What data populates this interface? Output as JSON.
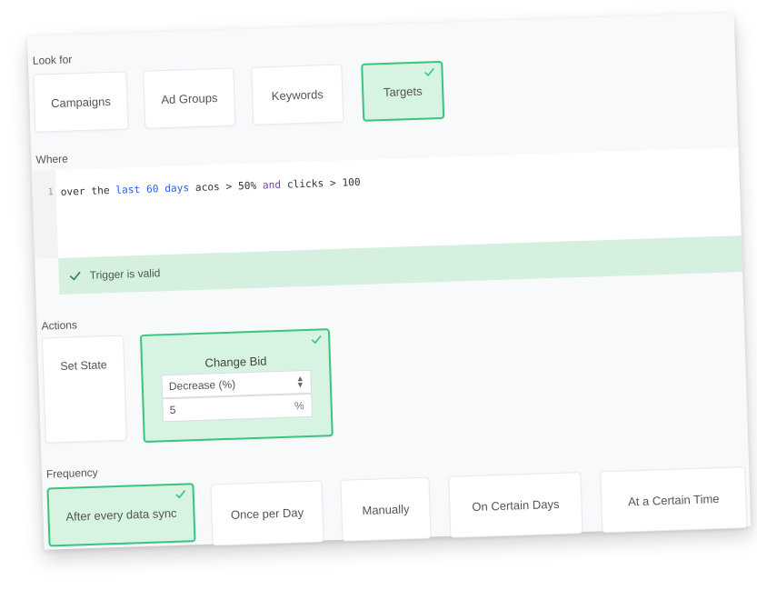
{
  "look_for": {
    "label": "Look for",
    "options": [
      {
        "label": "Campaigns",
        "selected": false
      },
      {
        "label": "Ad Groups",
        "selected": false
      },
      {
        "label": "Keywords",
        "selected": false
      },
      {
        "label": "Targets",
        "selected": true
      }
    ]
  },
  "where": {
    "label": "Where",
    "line_number": "1",
    "code_tokens": {
      "over_the": "over the ",
      "last": "last",
      "sp1": " ",
      "sixty": "60",
      "sp2": " ",
      "days": "days",
      "acos_part": " acos > 50% ",
      "and": "and",
      "clicks_part": " clicks > 100"
    },
    "validation": {
      "icon": "check-icon",
      "text": "Trigger is valid"
    }
  },
  "actions": {
    "label": "Actions",
    "set_state": {
      "label": "Set State",
      "selected": false
    },
    "change_bid": {
      "label": "Change Bid",
      "selected": true,
      "mode_selected": "Decrease (%)",
      "value": "5",
      "unit": "%"
    }
  },
  "frequency": {
    "label": "Frequency",
    "options": [
      {
        "label": "After every data sync",
        "selected": true
      },
      {
        "label": "Once per Day",
        "selected": false
      },
      {
        "label": "Manually",
        "selected": false
      },
      {
        "label": "On Certain Days",
        "selected": false
      },
      {
        "label": "At a Certain Time",
        "selected": false
      }
    ]
  },
  "colors": {
    "accent_green": "#3ac47d",
    "selected_bg": "#d6f4e1",
    "valid_bar_bg": "#d6f0e0",
    "keyword_purple": "#7a3e9d",
    "keyword_blue": "#2a5cff"
  }
}
